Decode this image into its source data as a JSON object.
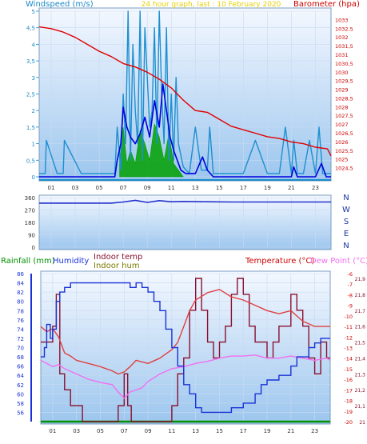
{
  "colors": {
    "panel_bg_top": "#f4f8ff",
    "panel_bg_bottom": "#9cc6ee",
    "outer_bg": "#ffffff",
    "windspeed": "#1e8fd0",
    "windspeed_avg": "#0000dd",
    "windgust_fill": "#00a000",
    "barometer": "#e00000",
    "winddir": "#2233cc",
    "humidity": "#1a33d6",
    "indoor_temp": "#8a1030",
    "indoor_hum": "#7a7a00",
    "temperature": "#e04040",
    "dewpoint": "#f070f0",
    "rainfall": "#009000",
    "axis_left": "#1a8ac8",
    "axis_right": "#cc0000"
  },
  "chart_data": [
    {
      "type": "line",
      "title": "24 hour graph, last : 10 February 2020",
      "ylabel_left": "Windspeed (m/s)",
      "ylabel_right": "Barometer (hpa)",
      "ylim_left": [
        0,
        5
      ],
      "ylim_right": [
        1024,
        1033.5
      ],
      "yticks_left": [
        "0",
        "0,5",
        "1",
        "1,5",
        "2",
        "2,5",
        "3",
        "3,5",
        "4",
        "4,5",
        "5"
      ],
      "yticks_right": [
        "1024,5",
        "1025",
        "1025,5",
        "1026",
        "1026,5",
        "1027",
        "1027,5",
        "1028",
        "1028,5",
        "1029",
        "1029,5",
        "1030",
        "1030,5",
        "1031",
        "1031,5",
        "1032",
        "1032,5",
        "1033"
      ],
      "xticks": [
        "01",
        "03",
        "05",
        "07",
        "09",
        "11",
        "13",
        "15",
        "17",
        "19",
        "21",
        "23"
      ],
      "xlim_hours": [
        0,
        24.3
      ],
      "series": [
        {
          "name": "Barometer",
          "x": [
            0,
            1,
            2,
            3,
            4,
            5,
            6,
            7,
            8,
            9,
            10,
            11,
            12,
            13,
            14,
            15,
            16,
            17,
            18,
            19,
            20,
            21,
            22,
            23,
            24,
            24.3
          ],
          "values": [
            1032.6,
            1032.5,
            1032.3,
            1032.0,
            1031.6,
            1031.2,
            1030.9,
            1030.5,
            1030.3,
            1030.0,
            1029.6,
            1029.1,
            1028.4,
            1027.8,
            1027.7,
            1027.3,
            1026.9,
            1026.7,
            1026.5,
            1026.3,
            1026.2,
            1026.0,
            1025.9,
            1025.7,
            1025.6,
            1025.2
          ]
        },
        {
          "name": "Windspeed",
          "x": [
            0,
            0.5,
            0.6,
            1.5,
            2.0,
            2.1,
            3.5,
            4.0,
            5.5,
            6.3,
            6.5,
            6.8,
            7.0,
            7.2,
            7.4,
            7.6,
            7.8,
            8.0,
            8.2,
            8.4,
            8.6,
            8.8,
            9.0,
            9.2,
            9.4,
            9.6,
            9.8,
            10.0,
            10.2,
            10.4,
            10.6,
            10.8,
            11.0,
            11.2,
            11.4,
            11.6,
            12.0,
            12.5,
            13.0,
            13.5,
            14.0,
            14.2,
            14.5,
            15.0,
            16.0,
            17.0,
            18.0,
            19.0,
            20.0,
            20.5,
            21.0,
            21.2,
            21.5,
            22.0,
            22.5,
            23.0,
            23.3,
            23.6,
            24.0,
            24.3
          ],
          "values": [
            0.1,
            0.1,
            1.1,
            0.1,
            0.1,
            1.1,
            0.1,
            0.1,
            0.1,
            0.1,
            1.5,
            0.2,
            2.5,
            1.0,
            5.0,
            0.5,
            4.0,
            2.0,
            1.0,
            5.0,
            0.5,
            4.5,
            3.0,
            1.5,
            2.0,
            4.5,
            1.0,
            5.0,
            2.5,
            1.0,
            4.5,
            0.5,
            2.5,
            0.5,
            3.0,
            1.0,
            0.3,
            0.1,
            1.5,
            0.2,
            0.2,
            1.5,
            0.1,
            0.1,
            0.1,
            0.1,
            1.1,
            0.1,
            0.1,
            1.5,
            0.1,
            1.1,
            0.1,
            0.1,
            1.1,
            0.1,
            1.5,
            0.1,
            0.1,
            0.1
          ]
        },
        {
          "name": "Average windspeed",
          "x": [
            0,
            6.3,
            6.5,
            6.8,
            7.0,
            7.3,
            7.6,
            8.0,
            8.4,
            8.8,
            9.2,
            9.6,
            10.0,
            10.3,
            10.6,
            10.9,
            11.2,
            11.5,
            11.8,
            12.2,
            13.0,
            13.6,
            14.0,
            14.5,
            15.0,
            21.0,
            21.2,
            21.5,
            23.0,
            23.5,
            23.9,
            24.3
          ],
          "values": [
            0,
            0,
            0.5,
            1.0,
            2.1,
            1.5,
            1.2,
            1.0,
            1.3,
            1.8,
            1.2,
            2.3,
            1.5,
            2.8,
            2.0,
            1.2,
            0.8,
            0.5,
            0.2,
            0.1,
            0.1,
            0.6,
            0.2,
            0,
            0,
            0,
            0.3,
            0,
            0,
            0.4,
            0,
            0
          ]
        },
        {
          "name": "Wind gust",
          "x": [
            6.7,
            7.0,
            7.3,
            7.6,
            8.0,
            8.4,
            8.8,
            9.2,
            9.6,
            10.0,
            10.4,
            10.8,
            11.2,
            11.6,
            12.0
          ],
          "values": [
            0.5,
            1.5,
            0.4,
            0.8,
            0.4,
            1.4,
            1.0,
            0.5,
            1.6,
            1.2,
            0.5,
            1.3,
            0.4,
            0.2,
            0
          ]
        }
      ]
    },
    {
      "type": "line",
      "ylabel_right": [
        "N",
        "W",
        "S",
        "E",
        "N"
      ],
      "ylim": [
        0,
        360
      ],
      "yticks": [
        "0",
        "90",
        "180",
        "270",
        "360"
      ],
      "series": [
        {
          "name": "Wind direction",
          "x": [
            0,
            6,
            7,
            8,
            9,
            10,
            11,
            12,
            14,
            16,
            24.3
          ],
          "values": [
            320,
            320,
            328,
            340,
            325,
            338,
            330,
            332,
            330,
            328,
            328
          ]
        }
      ]
    },
    {
      "type": "line",
      "legend": [
        "Rainfall (mm)",
        "Humidity",
        "Indoor temp",
        "Indoor hum",
        "Temperature (°C)",
        "Dew Point (°C)"
      ],
      "ylim_left": [
        54,
        86
      ],
      "yticks_left": [
        "56",
        "58",
        "60",
        "62",
        "64",
        "66",
        "68",
        "70",
        "72",
        "74",
        "76",
        "78",
        "80",
        "82",
        "84",
        "86"
      ],
      "ylim_right": [
        -20,
        -6
      ],
      "yticks_right": [
        "-20",
        "-19",
        "-18",
        "-17",
        "-16",
        "-15",
        "-14",
        "-13",
        "-12",
        "-11",
        "-10",
        "-9",
        "-8",
        "-7",
        "-6"
      ],
      "yticks_temp_inner": [
        "21",
        "21,1",
        "21,2",
        "21,3",
        "21,4",
        "21,5",
        "21,6",
        "21,7",
        "21,8",
        "21,9"
      ],
      "xticks": [
        "01",
        "03",
        "05",
        "07",
        "09",
        "11",
        "13",
        "15",
        "17",
        "19",
        "21",
        "23"
      ],
      "series": [
        {
          "name": "Humidity",
          "x": [
            0,
            0.3,
            0.5,
            0.8,
            1.0,
            1.3,
            1.6,
            2.0,
            2.5,
            3.0,
            4.0,
            5.0,
            6.0,
            7.0,
            7.5,
            8.0,
            8.5,
            9.0,
            9.5,
            10.0,
            10.5,
            11.0,
            11.5,
            12.0,
            12.5,
            13.0,
            13.5,
            14.0,
            15.0,
            16.0,
            17.0,
            18.0,
            18.5,
            19.0,
            20.0,
            21.0,
            21.5,
            22.0,
            22.5,
            23.0,
            23.5,
            24.3
          ],
          "values": [
            68,
            70,
            75,
            72,
            74,
            80,
            82,
            83,
            84,
            84,
            84,
            84,
            84,
            84,
            83,
            84,
            83,
            82,
            80,
            78,
            74,
            70,
            66,
            62,
            60,
            57,
            56,
            56,
            56,
            57,
            58,
            60,
            62,
            63,
            64,
            66,
            68,
            68,
            70,
            71,
            72,
            72
          ]
        },
        {
          "name": "Indoor temp",
          "x": [
            0,
            1.0,
            1.3,
            1.6,
            2.0,
            2.5,
            3.0,
            3.5,
            4.0,
            5.0,
            6.0,
            6.5,
            7.0,
            7.3,
            7.6,
            8.0,
            9.0,
            10.0,
            10.5,
            11.0,
            11.5,
            12.0,
            12.5,
            13.0,
            13.5,
            14.0,
            14.5,
            15.0,
            15.5,
            16.0,
            16.5,
            17.0,
            17.5,
            18.0,
            19.0,
            19.5,
            20.0,
            21.0,
            21.5,
            22.0,
            22.5,
            23.0,
            23.5,
            24.0,
            24.3
          ],
          "values": [
            21.5,
            21.6,
            21.8,
            21.3,
            21.2,
            21.1,
            21.1,
            21.0,
            21.0,
            21.0,
            21.0,
            21.1,
            21.3,
            21.1,
            21.0,
            21.0,
            21.0,
            21.0,
            21.0,
            21.1,
            21.3,
            21.4,
            21.7,
            21.9,
            21.7,
            21.5,
            21.4,
            21.5,
            21.6,
            21.8,
            21.9,
            21.8,
            21.6,
            21.5,
            21.4,
            21.5,
            21.6,
            21.8,
            21.7,
            21.6,
            21.4,
            21.3,
            21.5,
            21.4,
            21.4
          ]
        },
        {
          "name": "Temperature",
          "x": [
            0,
            0.5,
            1.0,
            1.5,
            2.0,
            2.5,
            3.0,
            4.0,
            5.0,
            6.0,
            6.5,
            7.0,
            7.5,
            8.0,
            9.0,
            10.0,
            11.0,
            11.5,
            12.0,
            12.5,
            13.0,
            14.0,
            15.0,
            16.0,
            17.0,
            18.0,
            19.0,
            20.0,
            21.0,
            22.0,
            23.0,
            24.0,
            24.3
          ],
          "values": [
            -11,
            -11.5,
            -11.2,
            -12.0,
            -13.5,
            -13.8,
            -14.2,
            -14.5,
            -14.8,
            -15.2,
            -15.5,
            -15.3,
            -14.8,
            -14.2,
            -14.5,
            -14.0,
            -13.2,
            -12.5,
            -11.0,
            -9.5,
            -8.5,
            -7.8,
            -7.5,
            -8.2,
            -8.5,
            -9.0,
            -9.5,
            -9.8,
            -9.5,
            -10.5,
            -11.0,
            -11.0,
            -11.0
          ]
        },
        {
          "name": "Dew Point",
          "x": [
            0,
            0.5,
            1.0,
            1.5,
            2.0,
            3.0,
            4.0,
            5.0,
            6.0,
            6.5,
            7.0,
            7.5,
            8.0,
            8.5,
            9.0,
            10.0,
            11.0,
            12.0,
            13.0,
            14.0,
            15.0,
            16.0,
            17.0,
            18.0,
            19.0,
            20.0,
            21.0,
            22.0,
            23.0,
            24.0,
            24.3
          ],
          "values": [
            -14.2,
            -14.5,
            -14.8,
            -14.6,
            -15.0,
            -15.5,
            -16.0,
            -16.3,
            -16.5,
            -17.2,
            -17.8,
            -17.2,
            -17.0,
            -16.8,
            -16.2,
            -15.5,
            -15.0,
            -14.8,
            -14.5,
            -14.3,
            -14.0,
            -13.8,
            -13.8,
            -13.7,
            -14.0,
            -14.0,
            -13.8,
            -14.0,
            -14.2,
            -14.0,
            -14.2
          ]
        },
        {
          "name": "Rainfall",
          "x": [
            0,
            24.3
          ],
          "values": [
            0,
            0
          ]
        }
      ]
    }
  ]
}
